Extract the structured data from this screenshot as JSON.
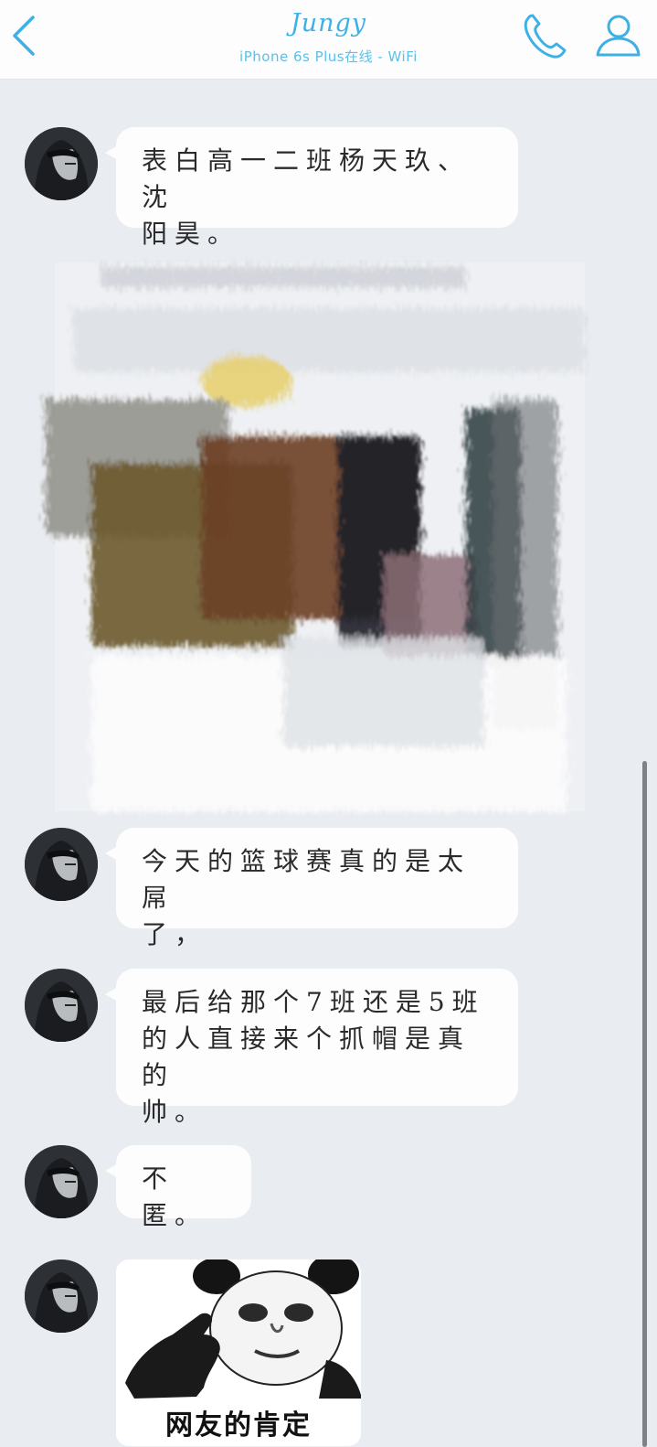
{
  "header": {
    "title": "Jungy",
    "subtitle": "iPhone 6s Plus在线 - WiFi",
    "accent_color": "#3fb0e6",
    "back_icon": "chevron-left-icon",
    "call_icon": "phone-icon",
    "profile_icon": "person-icon"
  },
  "messages": [
    {
      "type": "text",
      "lines": [
        "表白高一二班杨天玖、沈",
        "阳昊。"
      ]
    },
    {
      "type": "image",
      "description_icon": "painting-image"
    },
    {
      "type": "text",
      "lines": [
        "今天的篮球赛真的是太屌",
        "了，"
      ]
    },
    {
      "type": "text",
      "lines": [
        "最后给那个7班还是5班",
        "的人直接来个抓帽是真的",
        "帅。"
      ]
    },
    {
      "type": "text",
      "lines": [
        "不匿。"
      ]
    },
    {
      "type": "sticker",
      "caption": "网友的肯定"
    }
  ]
}
